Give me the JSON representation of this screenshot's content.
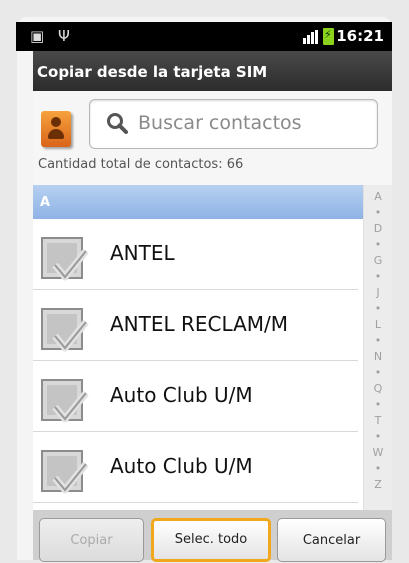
{
  "status_bar": {
    "time": "16:21",
    "left_icons": [
      "android-debug-icon",
      "usb-icon"
    ],
    "right_icons": [
      "signal-icon",
      "battery-charging-icon"
    ]
  },
  "title": "Copiar desde la tarjeta SIM",
  "search": {
    "placeholder": "Buscar contactos"
  },
  "total_contacts": "Cantidad total de contactos: 66",
  "section_letter": "A",
  "contacts": [
    {
      "name": "ANTEL",
      "checked": false
    },
    {
      "name": "ANTEL RECLAM/M",
      "checked": false
    },
    {
      "name": "Auto Club U/M",
      "checked": false
    },
    {
      "name": "Auto Club U/M",
      "checked": false
    }
  ],
  "index_letters": [
    "A",
    "•",
    "D",
    "•",
    "G",
    "•",
    "J",
    "•",
    "L",
    "•",
    "N",
    "•",
    "Q",
    "•",
    "T",
    "•",
    "W",
    "•",
    "Z"
  ],
  "buttons": {
    "copy": "Copiar",
    "select_all": "Selec. todo",
    "cancel": "Cancelar"
  },
  "colors": {
    "accent_focus": "#f2a81d",
    "section_header": "#a3c1ea"
  }
}
